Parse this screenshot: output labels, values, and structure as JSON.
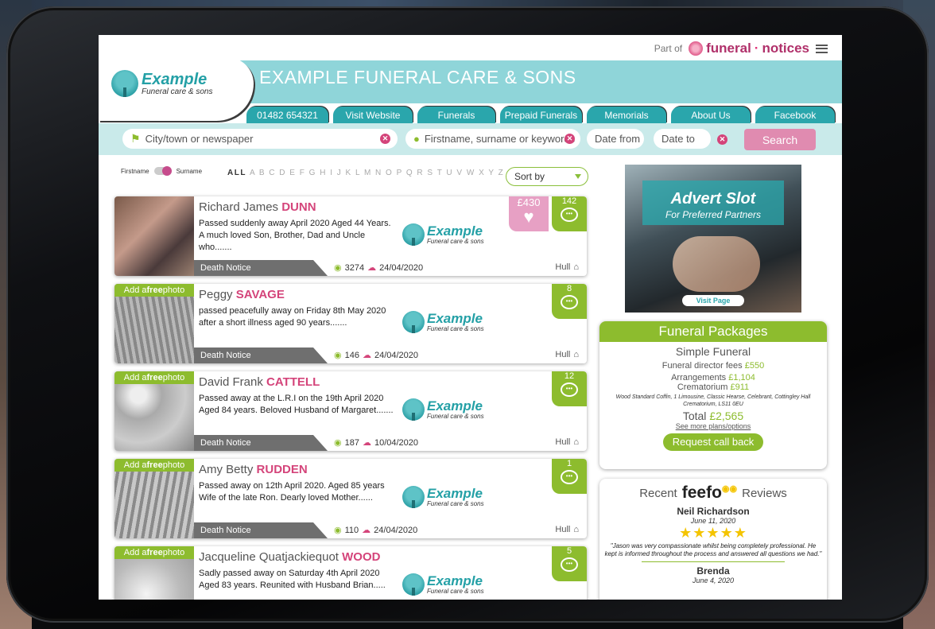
{
  "topbar": {
    "part_of": "Part of",
    "brand": "funeral",
    "brand_dot": "·",
    "brand_tail": "notices"
  },
  "header": {
    "title": "EXAMPLE FUNERAL CARE & SONS",
    "logo_big": "Example",
    "logo_small": "Funeral care & sons"
  },
  "tabs": [
    "01482 654321",
    "Visit Website",
    "Funerals",
    "Prepaid Funerals",
    "Memorials",
    "About Us",
    "Facebook"
  ],
  "search": {
    "location_placeholder": "City/town or newspaper",
    "name_placeholder": "Firstname, surname or keywords",
    "date_from": "Date from",
    "date_to": "Date to",
    "button": "Search"
  },
  "filter": {
    "firstname": "Firstname",
    "surname": "Surname",
    "all": "ALL",
    "letters": "A B C D E F G H I J K L M N O P Q R S T U V W X Y Z",
    "sort": "Sort by"
  },
  "notices": [
    {
      "first": "Richard James",
      "last": "DUNN",
      "desc": "Passed suddenly away April 2020 Aged 44 Years. A much loved Son, Brother, Dad and Uncle who.......",
      "views": "3274",
      "date": "24/04/2020",
      "location": "Hull",
      "comments": "142",
      "donation": "£430",
      "add_photo": "",
      "type": "Death Notice"
    },
    {
      "first": "Peggy",
      "last": "SAVAGE",
      "desc": "passed peacefully away on Friday 8th May 2020 after a short illness aged 90 years.......",
      "views": "146",
      "date": "24/04/2020",
      "location": "Hull",
      "comments": "8",
      "add_photo": "Add a free photo",
      "type": "Death Notice"
    },
    {
      "first": "David Frank",
      "last": "CATTELL",
      "desc": "Passed away at the L.R.I on the 19th April 2020 Aged 84 years. Beloved Husband of Margaret.......",
      "views": "187",
      "date": "10/04/2020",
      "location": "Hull",
      "comments": "12",
      "add_photo": "Add a free photo",
      "type": "Death Notice"
    },
    {
      "first": "Amy Betty",
      "last": "RUDDEN",
      "desc": "Passed away on 12th April 2020. Aged 85 years Wife of the late Ron. Dearly loved Mother......",
      "views": "110",
      "date": "24/04/2020",
      "location": "Hull",
      "comments": "1",
      "add_photo": "Add a free photo",
      "type": "Death Notice"
    },
    {
      "first": "Jacqueline Quatjackiequot",
      "last": "WOOD",
      "desc": "Sadly passed away on Saturday 4th April 2020 Aged 83 years. Reunited with Husband Brian.....",
      "views": "",
      "date": "",
      "location": "",
      "comments": "5",
      "add_photo": "Add a free photo",
      "type": ""
    }
  ],
  "advert": {
    "title": "Advert Slot",
    "subtitle": "For Preferred Partners",
    "button": "Visit Page"
  },
  "packages": {
    "title": "Funeral Packages",
    "plan": "Simple Funeral",
    "director_label": "Funeral director fees",
    "director_price": "£550",
    "arrangements_label": "Arrangements",
    "arrangements_price": "£1,104",
    "crematorium_label": "Crematorium",
    "crematorium_price": "£911",
    "details": "Wood Standard Coffin, 1 Limousine, Classic Hearse, Celebrant, Cottingley Hall Crematorium, LS11 0EU",
    "total_label": "Total",
    "total_price": "£2,565",
    "more": "See more plans/options",
    "callback": "Request call back"
  },
  "reviews": {
    "recent": "Recent",
    "brand": "feefo",
    "reviews_label": "Reviews",
    "items": [
      {
        "name": "Neil Richardson",
        "date": "June 11, 2020",
        "stars": "★★★★★",
        "text": "\"Jason was very compassionate whilst being completely professional. He kept is informed throughout the process and answered all questions we had.\""
      },
      {
        "name": "Brenda",
        "date": "June 4, 2020"
      }
    ]
  },
  "colors": {
    "teal": "#2aa6ac",
    "light_teal": "#8fd5d9",
    "green": "#8dbc2e",
    "pink": "#d4447a"
  }
}
